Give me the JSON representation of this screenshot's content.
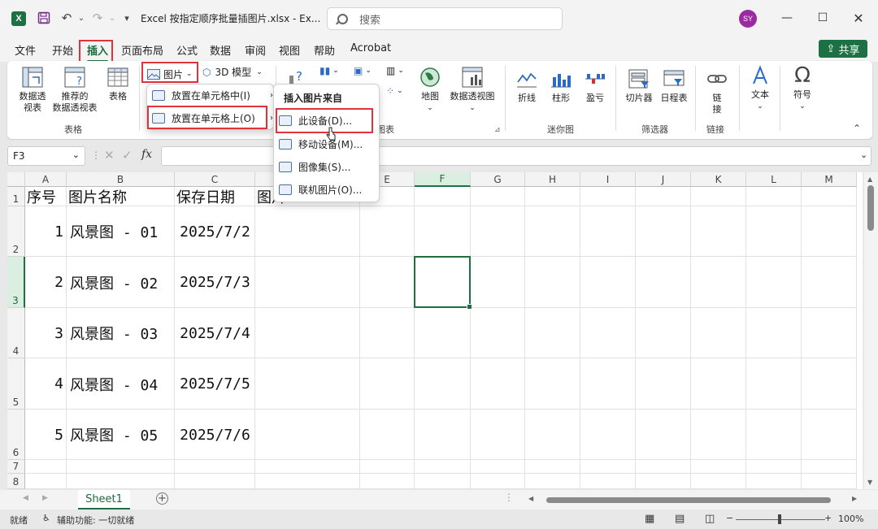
{
  "titlebar": {
    "logo": "X",
    "doc_title": "Excel 按指定顺序批量插图片.xlsx  -  Ex...",
    "search_placeholder": "搜索",
    "avatar_initials": "SY"
  },
  "tabs": [
    "文件",
    "开始",
    "插入",
    "页面布局",
    "公式",
    "数据",
    "审阅",
    "视图",
    "帮助",
    "Acrobat"
  ],
  "active_tab": "插入",
  "share_label": "共享",
  "ribbon": {
    "pivot_table": "数据透\n视表",
    "recommended_pivot": "推荐的\n数据透视表",
    "table": "表格",
    "group_tables": "表格",
    "picture": "图片",
    "model_3d": "3D 模型",
    "maps": "地图",
    "pivot_chart": "数据透视图",
    "group_charts": "图表",
    "line": "折线",
    "column": "柱形",
    "win_loss": "盈亏",
    "group_sparklines": "迷你图",
    "slicer": "切片器",
    "timeline": "日程表",
    "group_filters": "筛选器",
    "link": "链\n接",
    "group_links": "链接",
    "text": "文本",
    "symbol": "符号"
  },
  "picture_menu": {
    "place_in_cell": "放置在单元格中(I)",
    "place_over_cells": "放置在单元格上(O)"
  },
  "insert_from_menu": {
    "header": "插入图片来自",
    "this_device": "此设备(D)...",
    "mobile_device": "移动设备(M)...",
    "stock_images": "图像集(S)...",
    "online_pictures": "联机图片(O)..."
  },
  "formula_bar": {
    "name_box": "F3",
    "fx": "fx"
  },
  "columns": [
    "A",
    "B",
    "C",
    "D",
    "E",
    "F",
    "G",
    "H",
    "I",
    "J",
    "K",
    "L",
    "M"
  ],
  "selected_column": "F",
  "selected_row": "3",
  "headers": {
    "seq": "序号",
    "name": "图片名称",
    "date": "保存日期",
    "pic": "图片"
  },
  "rows": [
    {
      "row": "2",
      "seq": "1",
      "name": "风景图 - 01",
      "date": "2025/7/2"
    },
    {
      "row": "3",
      "seq": "2",
      "name": "风景图 - 02",
      "date": "2025/7/3"
    },
    {
      "row": "4",
      "seq": "3",
      "name": "风景图 - 03",
      "date": "2025/7/4"
    },
    {
      "row": "5",
      "seq": "4",
      "name": "风景图 - 04",
      "date": "2025/7/5"
    },
    {
      "row": "6",
      "seq": "5",
      "name": "风景图 - 05",
      "date": "2025/7/6"
    }
  ],
  "extra_rows": [
    "7",
    "8"
  ],
  "sheet_tab": "Sheet1",
  "status": {
    "ready": "就绪",
    "accessibility": "辅助功能: 一切就绪",
    "zoom": "100%"
  },
  "colors": {
    "excel_green": "#1d7044",
    "highlight_red": "#e0333c",
    "avatar_purple": "#9b2aa0"
  }
}
